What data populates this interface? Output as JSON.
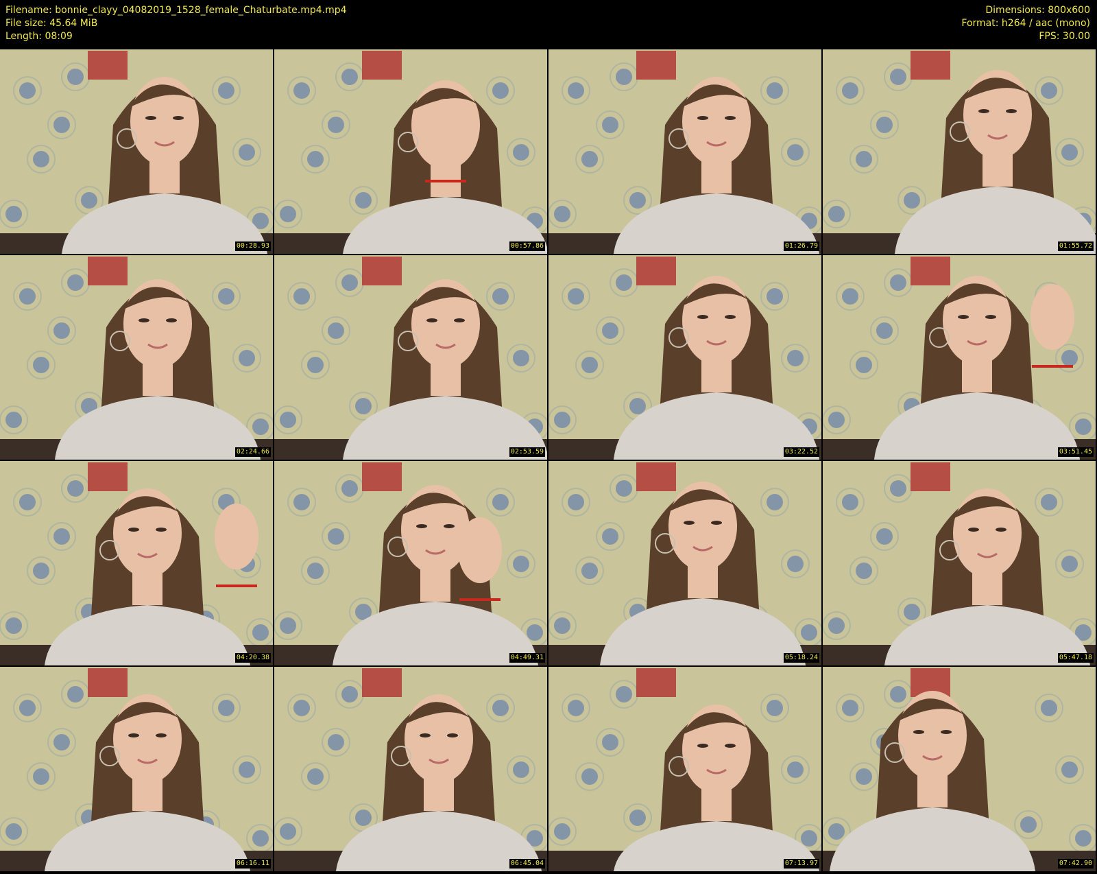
{
  "header": {
    "filename_line": "Filename: bonnie_clayy_04082019_1528_female_Chaturbate.mp4.mp4",
    "filesize_line": "File size: 45.64 MiB",
    "length_line": "Length: 08:09",
    "dimensions_line": "Dimensions: 800x600",
    "format_line": "Format: h264 / aac (mono)",
    "fps_line": "FPS: 30.00"
  },
  "colors": {
    "background": "#000000",
    "text": "#f2e94e",
    "wallpaper": "#c9c49a",
    "sweater": "#d8d2cc",
    "hair": "#5a3f2b",
    "skin": "#e8c0a6"
  },
  "thumbnails": [
    {
      "timestamp": "00:28.93"
    },
    {
      "timestamp": "00:57.86"
    },
    {
      "timestamp": "01:26.79"
    },
    {
      "timestamp": "01:55.72"
    },
    {
      "timestamp": "02:24.66"
    },
    {
      "timestamp": "02:53.59"
    },
    {
      "timestamp": "03:22.52"
    },
    {
      "timestamp": "03:51.45"
    },
    {
      "timestamp": "04:20.38"
    },
    {
      "timestamp": "04:49.31"
    },
    {
      "timestamp": "05:18.24"
    },
    {
      "timestamp": "05:47.18"
    },
    {
      "timestamp": "06:16.11"
    },
    {
      "timestamp": "06:45.04"
    },
    {
      "timestamp": "07:13.97"
    },
    {
      "timestamp": "07:42.90"
    }
  ]
}
